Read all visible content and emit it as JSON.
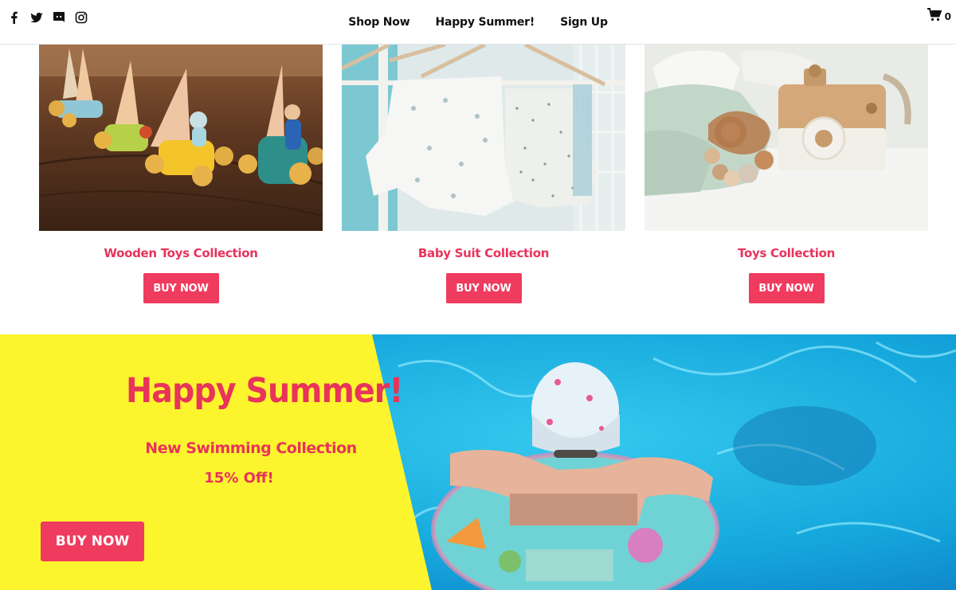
{
  "header": {
    "social": [
      {
        "icon": "facebook-icon"
      },
      {
        "icon": "twitter-icon"
      },
      {
        "icon": "discord-icon"
      },
      {
        "icon": "instagram-icon"
      }
    ],
    "nav": [
      "Shop Now",
      "Happy Summer!",
      "Sign Up"
    ],
    "cart": {
      "icon": "cart-icon",
      "count": "0"
    }
  },
  "collections": [
    {
      "title": "Wooden Toys Collection",
      "button": "BUY NOW"
    },
    {
      "title": "Baby Suit Collection",
      "button": "BUY NOW"
    },
    {
      "title": "Toys Collection",
      "button": "BUY NOW"
    }
  ],
  "banner": {
    "title": "Happy Summer!",
    "subtitle": "New Swimming Collection",
    "offer": "15% Off!",
    "button": "BUY NOW"
  },
  "colors": {
    "accent": "#ef3b5e",
    "accent_text": "#e8335b",
    "banner_yellow": "#fcf52e",
    "pool_blue": "#1ab0e0"
  }
}
